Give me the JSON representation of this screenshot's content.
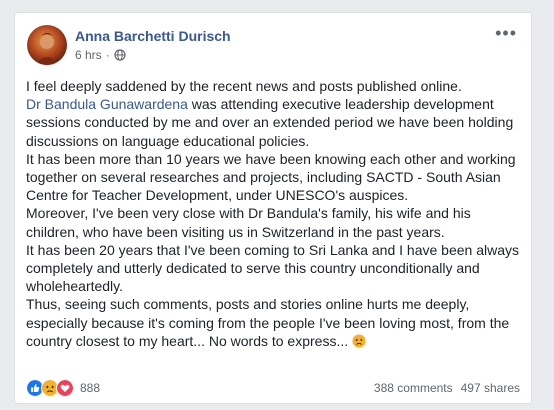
{
  "post": {
    "author": "Anna Barchetti Durisch",
    "time": "6 hrs",
    "privacy_icon": "globe-icon",
    "menu_icon": "more-dots-icon",
    "lines": [
      {
        "text": "I feel deeply saddened by the recent news and posts published online."
      },
      {
        "mention": "Dr Bandula Gunawardena",
        "text": " was attending executive leadership development sessions conducted by me and over an extended period we have been holding discussions on language educational policies."
      },
      {
        "text": "It has been more than 10 years we have been knowing each other and working together on several researches and projects, including SACTD - South Asian Centre for Teacher Development, under UNESCO's auspices."
      },
      {
        "text": "Moreover, I've been very close with Dr Bandula's family, his wife and his children, who have been visiting us in Switzerland in the past years."
      },
      {
        "text": "It has been 20 years that I've been coming to Sri Lanka and I have been always completely and utterly dedicated to serve this country unconditionally and wholeheartedly."
      },
      {
        "text": "Thus, seeing such comments, posts and stories online hurts me deeply, especially because it's coming from the people I've been loving most, from the country closest to my heart... No words to express... "
      }
    ],
    "end_emoji": "crying-face-emoji"
  },
  "stats": {
    "reaction_icons": [
      "like-icon",
      "sad-icon",
      "love-icon"
    ],
    "reaction_count": "888",
    "comments": "388 comments",
    "shares": "497 shares"
  },
  "colors": {
    "link": "#385898",
    "text": "#1d2129",
    "muted": "#606770",
    "like": "#1877f2",
    "sad": "#f7b125",
    "love": "#f33e58"
  }
}
